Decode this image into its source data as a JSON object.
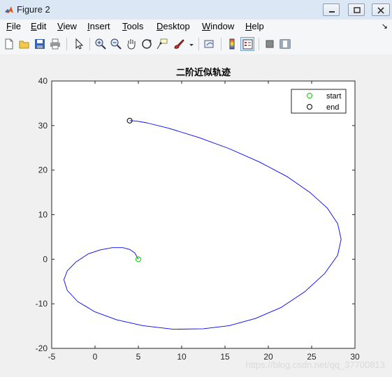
{
  "window": {
    "title": "Figure 2"
  },
  "menu": {
    "items": [
      {
        "label": "File",
        "u": "F",
        "rest": "ile"
      },
      {
        "label": "Edit",
        "u": "E",
        "rest": "dit"
      },
      {
        "label": "View",
        "u": "V",
        "rest": "iew"
      },
      {
        "label": "Insert",
        "u": "I",
        "rest": "nsert"
      },
      {
        "label": "Tools",
        "u": "T",
        "rest": "ools"
      },
      {
        "label": "Desktop",
        "u": "D",
        "rest": "esktop"
      },
      {
        "label": "Window",
        "u": "W",
        "rest": "indow"
      },
      {
        "label": "Help",
        "u": "H",
        "rest": "elp"
      }
    ]
  },
  "toolbar": {
    "icons": [
      "new-figure-icon",
      "open-icon",
      "save-icon",
      "print-icon",
      "pointer-icon",
      "zoom-in-icon",
      "zoom-out-icon",
      "pan-hand-icon",
      "rotate-3d-icon",
      "data-cursor-icon",
      "brush-icon",
      "link-plot-icon",
      "colorbar-icon",
      "legend-icon",
      "hide-plot-tools-icon",
      "show-plot-tools-icon"
    ]
  },
  "watermark": "https://blog.csdn.net/qq_37700813",
  "chart_data": {
    "type": "line",
    "title": "二阶近似轨迹",
    "xlabel": "",
    "ylabel": "",
    "xlim": [
      -5,
      30
    ],
    "ylim": [
      -20,
      40
    ],
    "xticks": [
      -5,
      0,
      5,
      10,
      15,
      20,
      25,
      30
    ],
    "yticks": [
      -20,
      -10,
      0,
      10,
      20,
      30,
      40
    ],
    "grid": false,
    "legend_position": "top-right",
    "line_color": "#0000ff",
    "series": [
      {
        "x": [
          5,
          4.6,
          4.0,
          3.2,
          2.0,
          0.6,
          -0.8,
          -2.2,
          -3.2,
          -3.6,
          -3.2,
          -2.0,
          0,
          2.5,
          5.5,
          9,
          12.5,
          15.5,
          18.5,
          21.5,
          24.2,
          26.5,
          28,
          28.4,
          28.0,
          26.8,
          24.8,
          22.2,
          19,
          15.5,
          12,
          8.5,
          6,
          4.8,
          4.0
        ],
        "y": [
          0,
          1.4,
          2.2,
          2.6,
          2.6,
          2.1,
          1.2,
          -0.6,
          -2.6,
          -4.6,
          -7.0,
          -9.5,
          -11.8,
          -13.6,
          -14.9,
          -15.7,
          -15.6,
          -14.9,
          -13.3,
          -10.8,
          -7.3,
          -3.2,
          0.9,
          4.5,
          8,
          11.5,
          15,
          18.5,
          21.8,
          24.8,
          27.3,
          29.4,
          30.6,
          31.0,
          31.1
        ]
      }
    ],
    "markers": [
      {
        "name": "start",
        "x": 5,
        "y": 0,
        "color": "#00cc00"
      },
      {
        "name": "end",
        "x": 4,
        "y": 31.1,
        "color": "#000000"
      }
    ],
    "legend": [
      {
        "label": "start",
        "color": "#00cc00"
      },
      {
        "label": "end",
        "color": "#000000"
      }
    ]
  }
}
